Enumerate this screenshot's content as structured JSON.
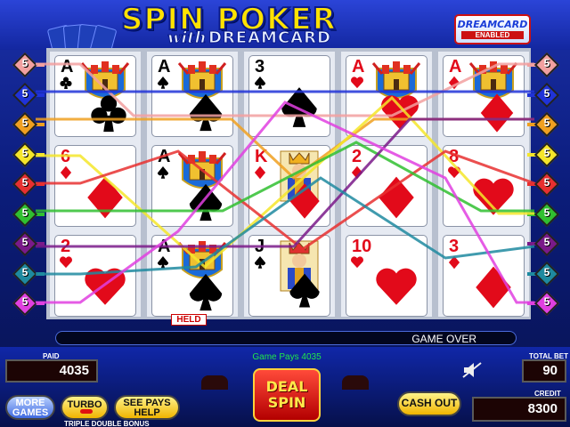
{
  "title": {
    "line1": "SPIN POKER",
    "line2_prefix": "with",
    "line2": "DREAMCARD"
  },
  "badge": {
    "brand": "DREAMCARD",
    "status": "ENABLED"
  },
  "paylines_left": [
    "5",
    "5",
    "5",
    "5",
    "5",
    "5",
    "5",
    "5",
    "5"
  ],
  "paylines_right": [
    "5",
    "5",
    "5",
    "5",
    "5",
    "5",
    "5",
    "5",
    "5"
  ],
  "payline_colors": [
    "#f2a0a0",
    "#2033d8",
    "#f0a020",
    "#f5e62a",
    "#e83030",
    "#30c030",
    "#7a1a8a",
    "#1e8aa0",
    "#e040e0"
  ],
  "reels": [
    {
      "cards": [
        {
          "rank": "A",
          "suit": "club",
          "dreamcard": true
        },
        {
          "rank": "6",
          "suit": "diamond",
          "dreamcard": false
        },
        {
          "rank": "2",
          "suit": "heart",
          "dreamcard": false
        }
      ]
    },
    {
      "cards": [
        {
          "rank": "A",
          "suit": "spade",
          "dreamcard": true
        },
        {
          "rank": "A",
          "suit": "spade",
          "dreamcard": true
        },
        {
          "rank": "A",
          "suit": "spade",
          "dreamcard": true
        }
      ]
    },
    {
      "cards": [
        {
          "rank": "3",
          "suit": "spade",
          "dreamcard": false
        },
        {
          "rank": "K",
          "suit": "diamond",
          "face": "king"
        },
        {
          "rank": "J",
          "suit": "spade",
          "face": "jack"
        }
      ]
    },
    {
      "cards": [
        {
          "rank": "A",
          "suit": "heart",
          "dreamcard": true
        },
        {
          "rank": "2",
          "suit": "diamond",
          "dreamcard": false
        },
        {
          "rank": "10",
          "suit": "heart",
          "dreamcard": false
        }
      ]
    },
    {
      "cards": [
        {
          "rank": "A",
          "suit": "diamond",
          "dreamcard": true
        },
        {
          "rank": "8",
          "suit": "heart",
          "dreamcard": false
        },
        {
          "rank": "3",
          "suit": "diamond",
          "dreamcard": false
        }
      ]
    }
  ],
  "held_label": "HELD",
  "status_message": "GAME OVER",
  "game_pays": "Game Pays 4035",
  "paid": {
    "label": "PAID",
    "value": "4035"
  },
  "total_bet": {
    "label": "TOTAL BET",
    "value": "90"
  },
  "credit": {
    "label": "CREDIT",
    "value": "8300"
  },
  "buttons": {
    "more_games": "MORE GAMES",
    "turbo": "TURBO",
    "see_pays": "SEE PAYS HELP",
    "deal_line1": "DEAL",
    "deal_line2": "SPIN",
    "cash_out": "CASH OUT"
  },
  "footer": "TRIPLE DOUBLE BONUS",
  "icons": {
    "sound": "speaker-muted-icon"
  }
}
